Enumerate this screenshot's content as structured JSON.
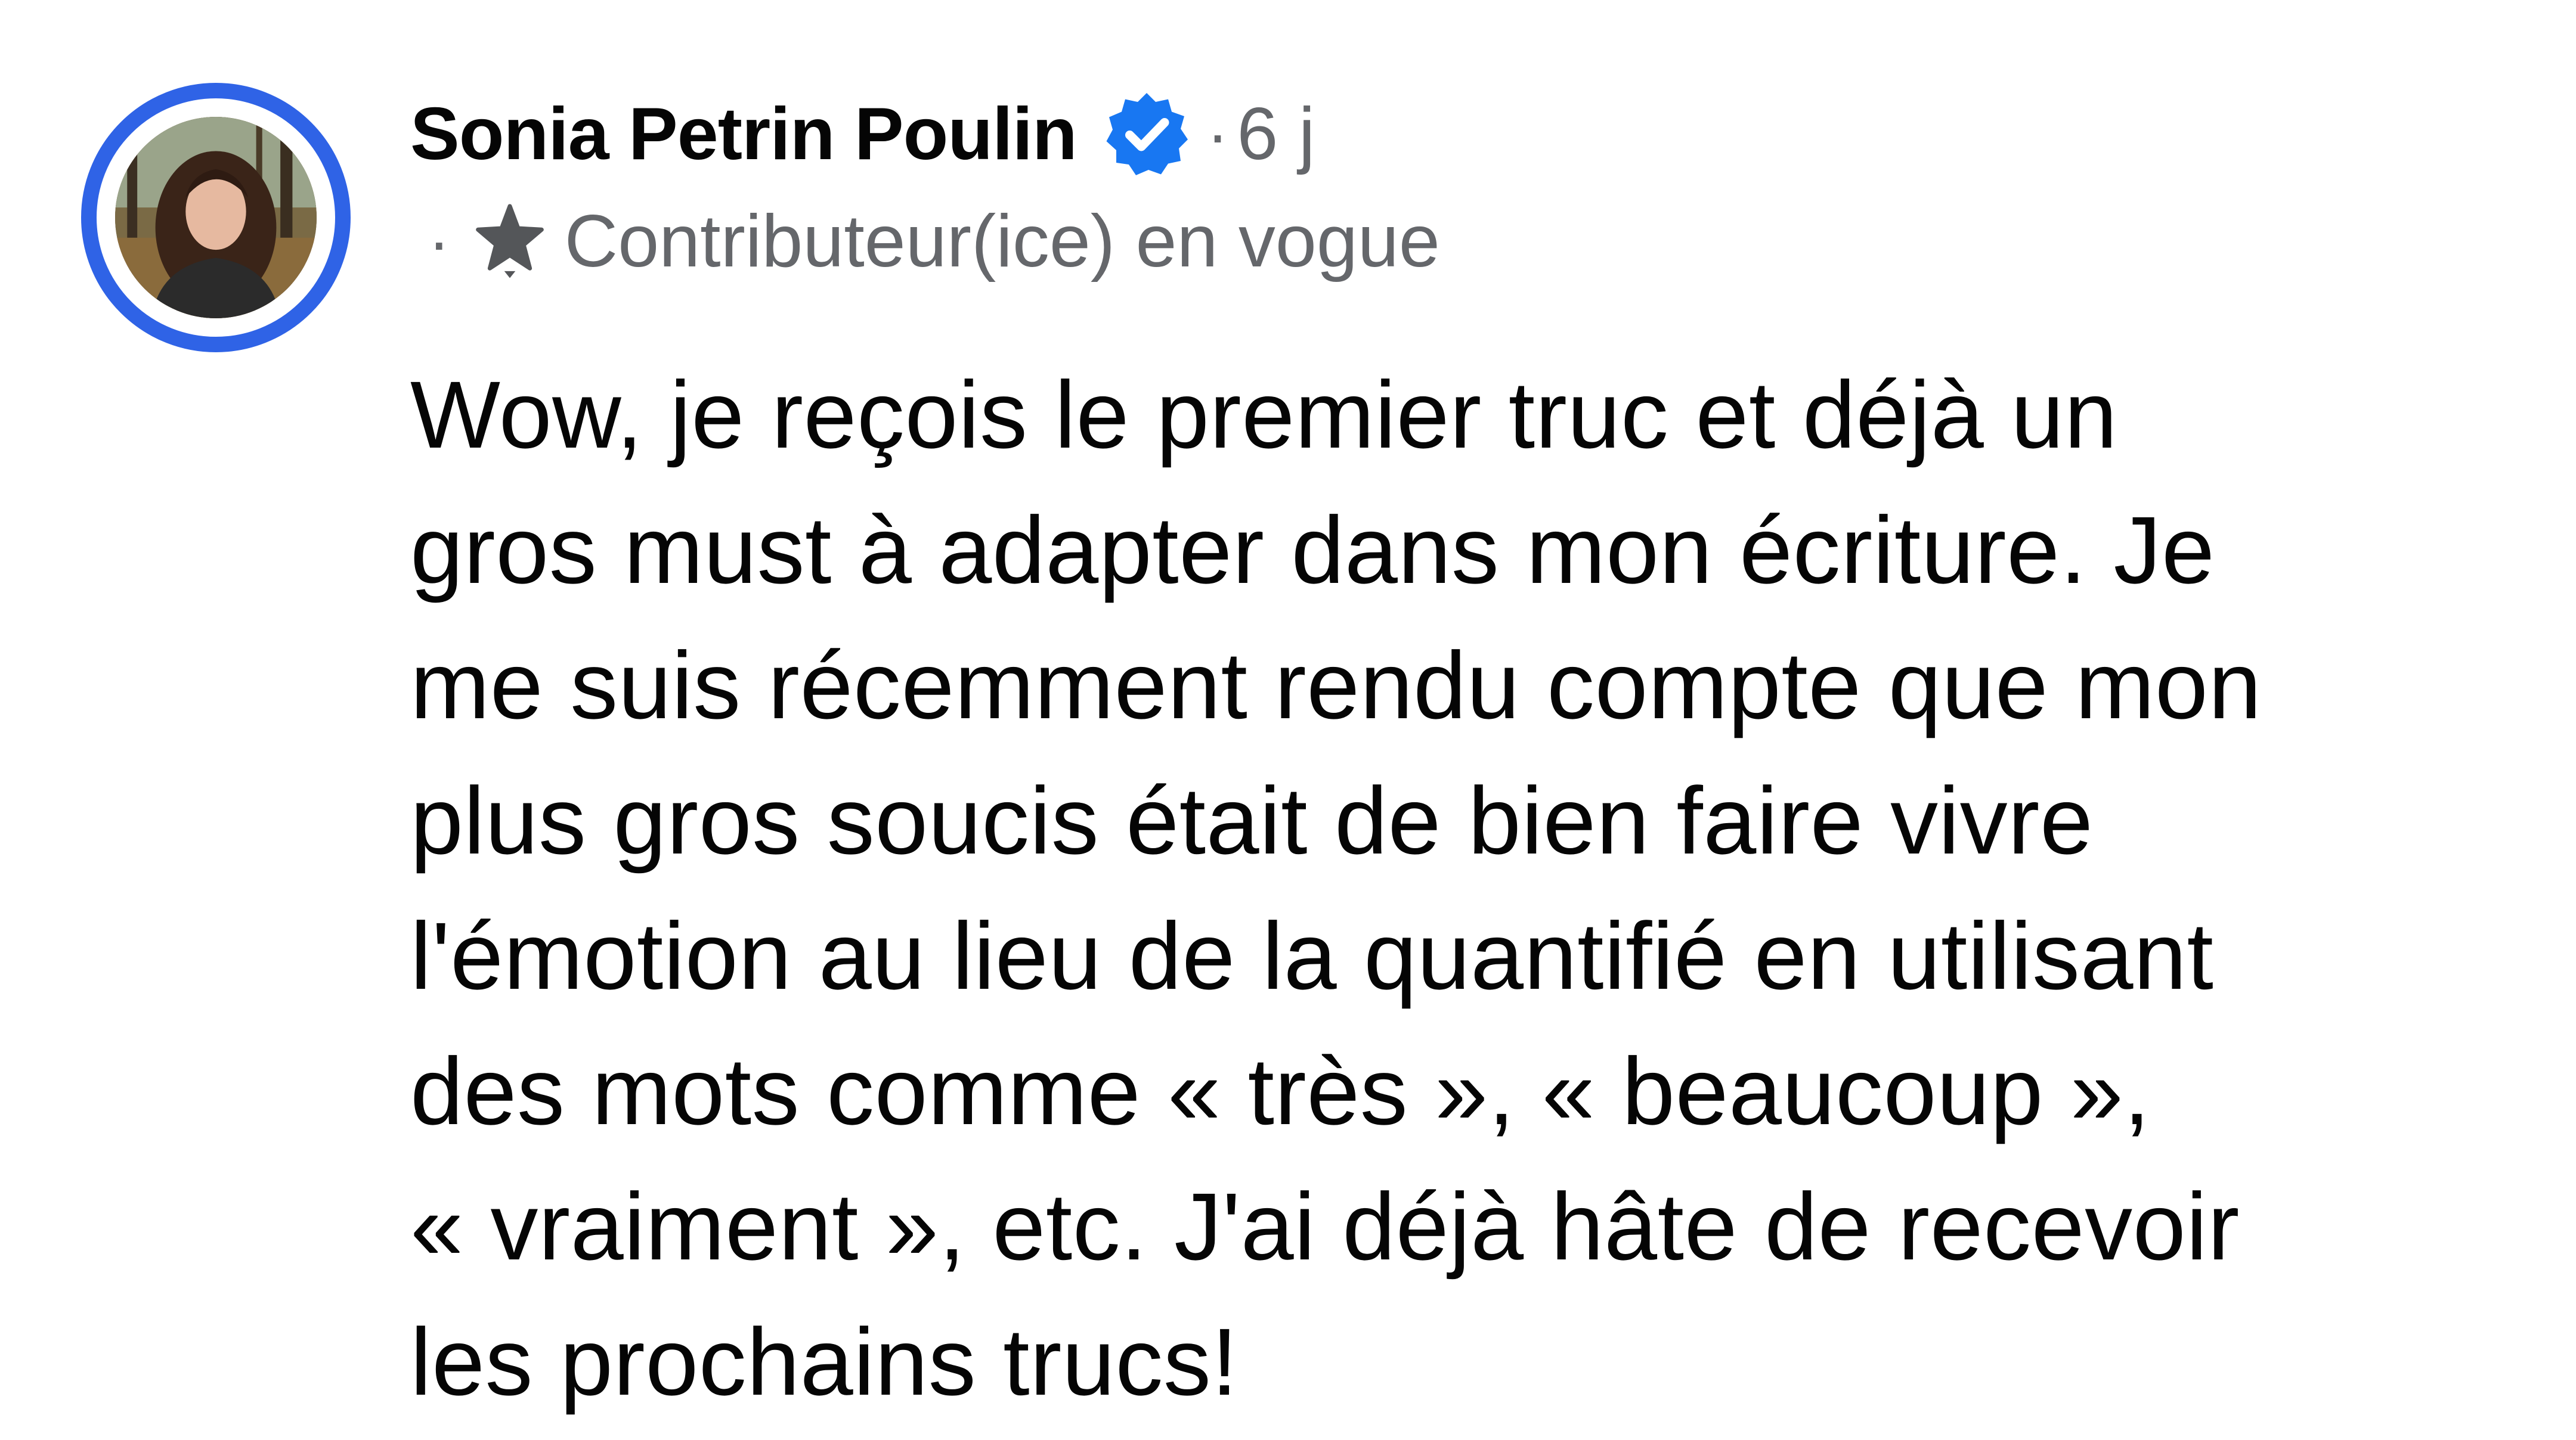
{
  "comment": {
    "author": {
      "name": "Sonia Petrin Poulin",
      "avatar_icon": "profile-photo",
      "verified_icon": "verified-badge-icon"
    },
    "meta_separator": "·",
    "timestamp": "6 j",
    "badge": {
      "separator": "·",
      "icon": "star-icon",
      "label": "Contributeur(ice) en vogue"
    },
    "text": "Wow, je reçois le premier truc et déjà un\ngros must à adapter dans mon écriture. Je\nme suis récemment rendu compte que mon\nplus gros soucis était de bien faire vivre\nl'émotion au lieu de la quantifié en utilisant\ndes mots comme « très », « beaucoup »,\n« vraiment », etc. J'ai déjà hâte de recevoir\nles prochains trucs!"
  },
  "colors": {
    "ring": "#2f63e6",
    "verified": "#1877f2",
    "text_primary": "#050505",
    "text_secondary": "#65676b"
  }
}
